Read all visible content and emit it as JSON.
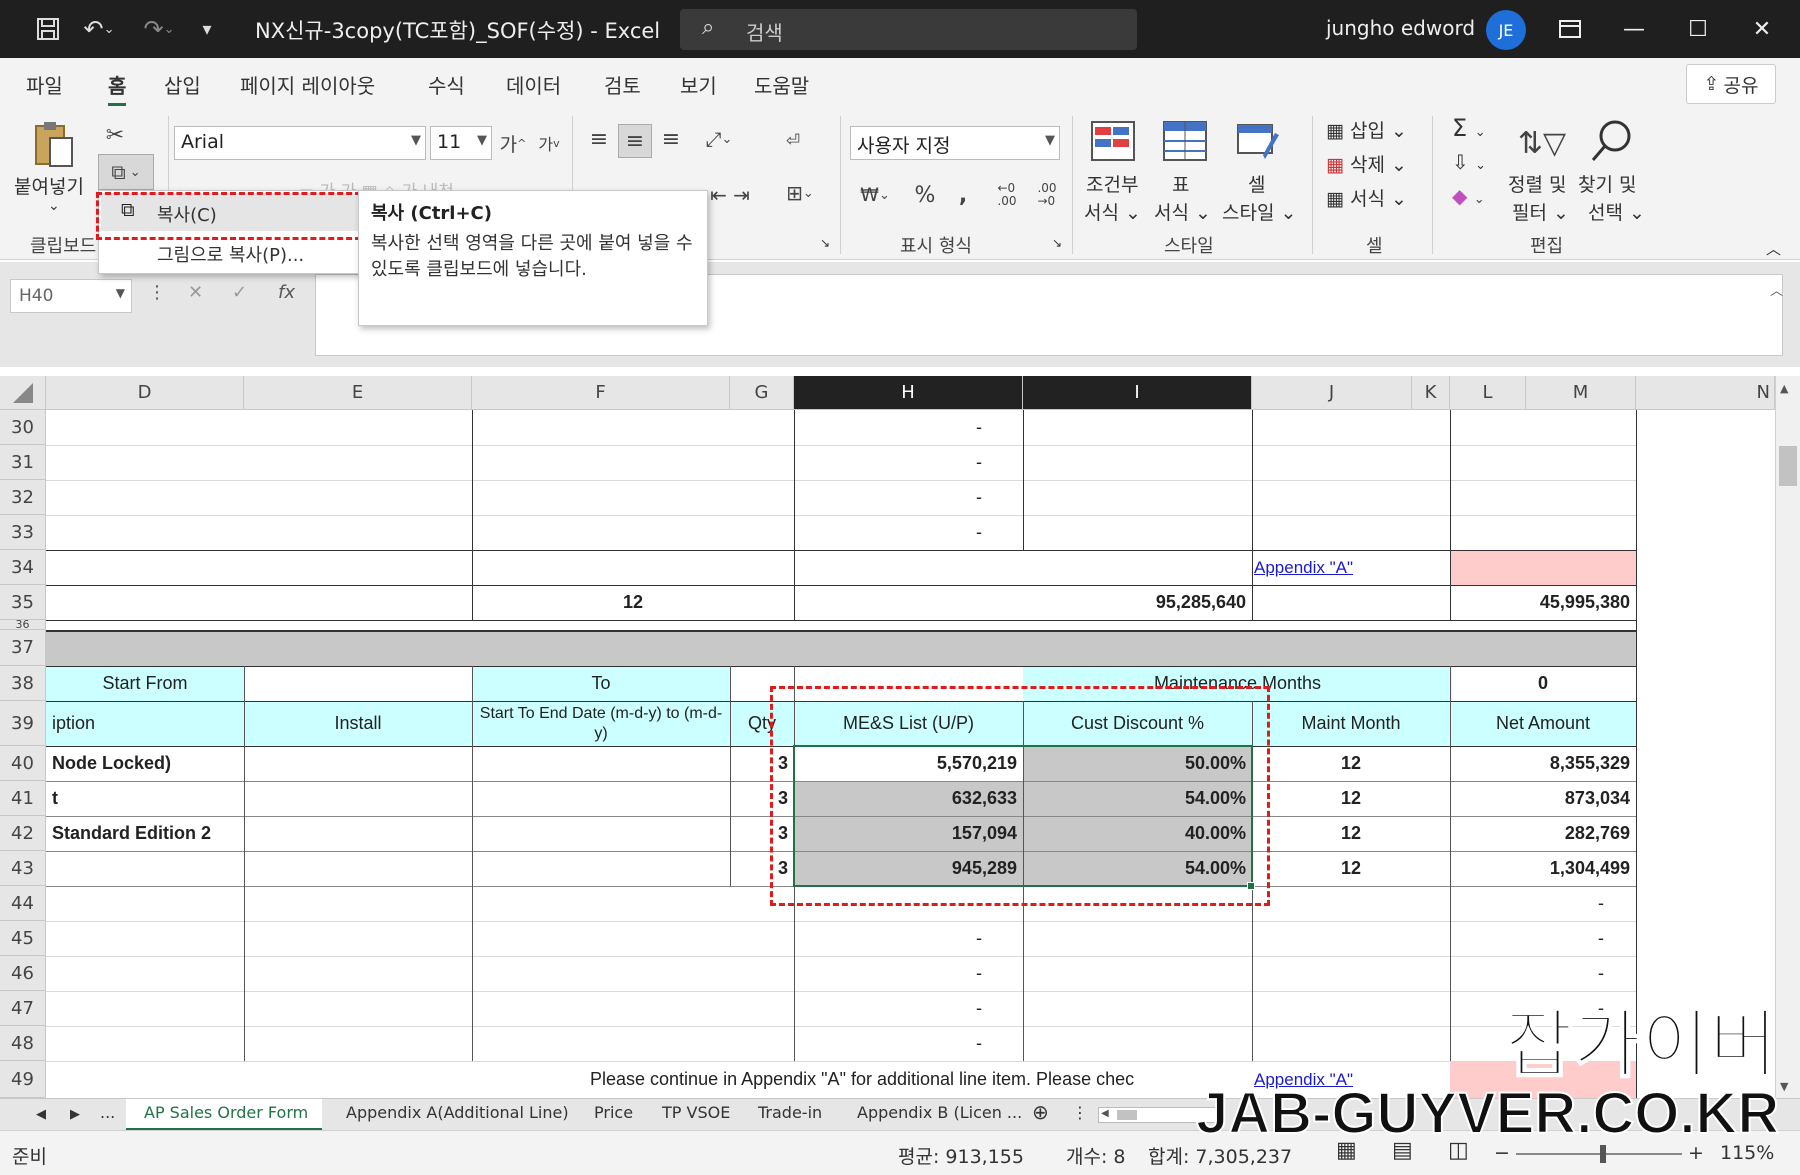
{
  "titlebar": {
    "doc_title": "NX신규-3copy(TC포함)_SOF(수정)  -  Excel",
    "search_placeholder": "검색",
    "user_name": "jungho edword",
    "avatar_initials": "JE"
  },
  "menu": {
    "file": "파일",
    "home": "홈",
    "insert": "삽입",
    "page_layout": "페이지 레이아웃",
    "formulas": "수식",
    "data": "데이터",
    "review": "검토",
    "view": "보기",
    "help": "도움말",
    "share": "공유"
  },
  "ribbon": {
    "paste": "붙여넣기",
    "clipboard_group": "클립보드",
    "font_name": "Arial",
    "font_size": "11",
    "number_format": "사용자 지정",
    "number_group": "표시 형식",
    "conditional_format": [
      "조건부",
      "서식"
    ],
    "table_format": [
      "표",
      "서식"
    ],
    "cell_style": [
      "셀",
      "스타일"
    ],
    "styles_group": "스타일",
    "insert_cells": "삽입",
    "delete_cells": "삭제",
    "format_cells": "서식",
    "cells_group": "셀",
    "sort_filter": [
      "정렬 및",
      "필터"
    ],
    "find_select": [
      "찾기 및",
      "선택"
    ],
    "editing_group": "편집"
  },
  "formula_bar": {
    "name_box": "H40",
    "formula": "=+"
  },
  "context_menu": {
    "copy": "복사(C)",
    "copy_as_picture": "그림으로 복사(P)..."
  },
  "tooltip": {
    "title": "복사 (Ctrl+C)",
    "body": "복사한 선택 영역을 다른 곳에 붙여 넣을 수 있도록 클립보드에 넣습니다."
  },
  "columns": [
    "D",
    "E",
    "F",
    "G",
    "H",
    "I",
    "J",
    "K",
    "L",
    "M",
    "N"
  ],
  "rows": [
    "30",
    "31",
    "32",
    "33",
    "34",
    "35",
    "36",
    "37",
    "38",
    "39",
    "40",
    "41",
    "42",
    "43",
    "44",
    "45",
    "46",
    "47",
    "48",
    "49"
  ],
  "sheet": {
    "dash": "-",
    "appendix_link": "Appendix \"A\"",
    "row35_qty": "12",
    "row35_total": "95,285,640",
    "row35_net": "45,995,380",
    "header38": {
      "start_from": "Start From",
      "to": "To",
      "maint_months": "Maintenance Months",
      "maint_value": "0"
    },
    "header39": {
      "description": "iption",
      "install": "Install",
      "dates": "Start To End Date    (m-d-y) to (m-d-y)",
      "qty": "Qty",
      "list": "ME&S List (U/P)",
      "discount": "Cust Discount %",
      "maint_month": "Maint Month",
      "net": "Net Amount"
    },
    "lines": [
      {
        "desc": "Node Locked)",
        "qty": "3",
        "list": "5,570,219",
        "discount": "50.00%",
        "maint": "12",
        "net": "8,355,329"
      },
      {
        "desc": "t",
        "qty": "3",
        "list": "632,633",
        "discount": "54.00%",
        "maint": "12",
        "net": "873,034"
      },
      {
        "desc": "Standard Edition 2",
        "qty": "3",
        "list": "157,094",
        "discount": "40.00%",
        "maint": "12",
        "net": "282,769"
      },
      {
        "desc": "",
        "qty": "3",
        "list": "945,289",
        "discount": "54.00%",
        "maint": "12",
        "net": "1,304,499"
      }
    ],
    "row49_text": "Please continue in Appendix \"A\" for additional line item. Please chec",
    "row49_link": "Appendix \"A\""
  },
  "sheet_tabs": [
    "AP Sales Order Form",
    "Appendix A(Additional Line)",
    "Price",
    "TP VSOE",
    "Trade-in",
    "Appendix B (Licen ..."
  ],
  "status": {
    "ready": "준비",
    "average": "평균: 913,155",
    "count": "개수: 8",
    "sum": "합계: 7,305,237",
    "zoom": "115%"
  },
  "watermark": {
    "korean": "잡가이버",
    "url": "JAB-GUYVER.CO.KR"
  },
  "colors": {
    "accent": "#217346",
    "header_fill": "#ccffff",
    "selection_fill": "#c8c8c8",
    "highlight_red": "#e01b1b",
    "pink_cell": "#ffcccc"
  }
}
